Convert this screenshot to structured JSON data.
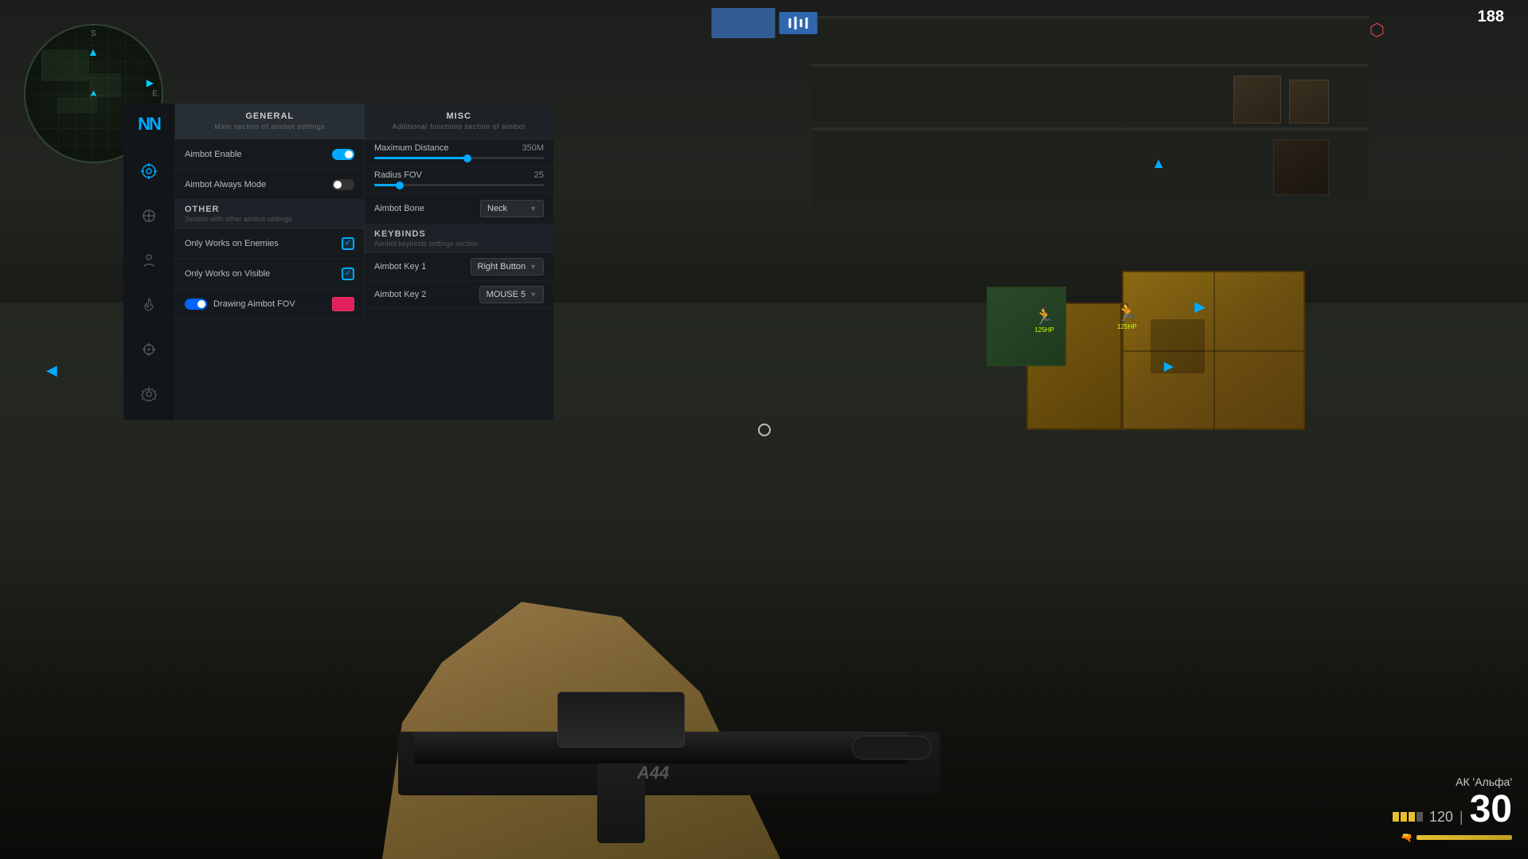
{
  "game": {
    "kill_counter": "188",
    "weapon_name": "АК 'Альфа'",
    "ammo_current": "30",
    "ammo_reserve": "120",
    "crosshair_visible": true
  },
  "top_bar": {
    "btn1_label": "",
    "btn2_label": "▐▐▌"
  },
  "minimap": {
    "north": "S",
    "south": "",
    "east": "E",
    "west": ""
  },
  "sidebar": {
    "logo": "NN",
    "icons": [
      {
        "name": "aimbot-icon",
        "symbol": "◎",
        "active": true
      },
      {
        "name": "target-icon",
        "symbol": "◉",
        "active": false
      },
      {
        "name": "player-icon",
        "symbol": "⊙",
        "active": false
      },
      {
        "name": "fire-icon",
        "symbol": "✦",
        "active": false
      },
      {
        "name": "crosshair-icon",
        "symbol": "⊕",
        "active": false
      },
      {
        "name": "settings-icon",
        "symbol": "⚙",
        "active": false
      }
    ]
  },
  "menu": {
    "tabs": [
      {
        "id": "general",
        "title": "GENERAL",
        "subtitle": "Main section of aimbot settings",
        "active": true
      },
      {
        "id": "misc",
        "title": "MISC",
        "subtitle": "Additional functions section of aimbot",
        "active": false
      }
    ],
    "left_column": {
      "sections": [
        {
          "id": "general-section",
          "title": "OTHER",
          "desc": "Section with other aimbot settings",
          "rows": [
            {
              "id": "aimbot-enable",
              "label": "Aimbot Enable",
              "control": "toggle",
              "value": true
            },
            {
              "id": "aimbot-always-mode",
              "label": "Aimbot Always Mode",
              "control": "toggle",
              "value": false
            }
          ]
        },
        {
          "id": "other-section",
          "title": "OTHER",
          "desc": "Section with other aimbot settings",
          "rows": [
            {
              "id": "only-works-enemies",
              "label": "Only Works on Enemies",
              "control": "check",
              "value": true
            },
            {
              "id": "only-works-visible",
              "label": "Only Works on Visible",
              "control": "check",
              "value": true
            }
          ]
        },
        {
          "id": "drawing-row",
          "label": "Drawing Aimbot FOV",
          "toggle_value": true,
          "color": "#e0205a"
        }
      ]
    },
    "right_column": {
      "sliders": [
        {
          "id": "max-distance",
          "label": "Maximum Distance",
          "value": "350M",
          "fill_percent": 55
        },
        {
          "id": "radius-fov",
          "label": "Radius FOV",
          "value": "25",
          "fill_percent": 15
        }
      ],
      "dropdowns": [
        {
          "id": "aimbot-bone",
          "label": "Aimbot Bone",
          "value": "Neck"
        }
      ],
      "keybinds_section": {
        "title": "KEYBINDS",
        "subtitle": "Aimbot keybinds settings section",
        "rows": [
          {
            "id": "aimbot-key-1",
            "label": "Aimbot Key 1",
            "value": "Right Button"
          },
          {
            "id": "aimbot-key-2",
            "label": "Aimbot Key 2",
            "value": "MOUSE 5"
          }
        ]
      }
    }
  }
}
